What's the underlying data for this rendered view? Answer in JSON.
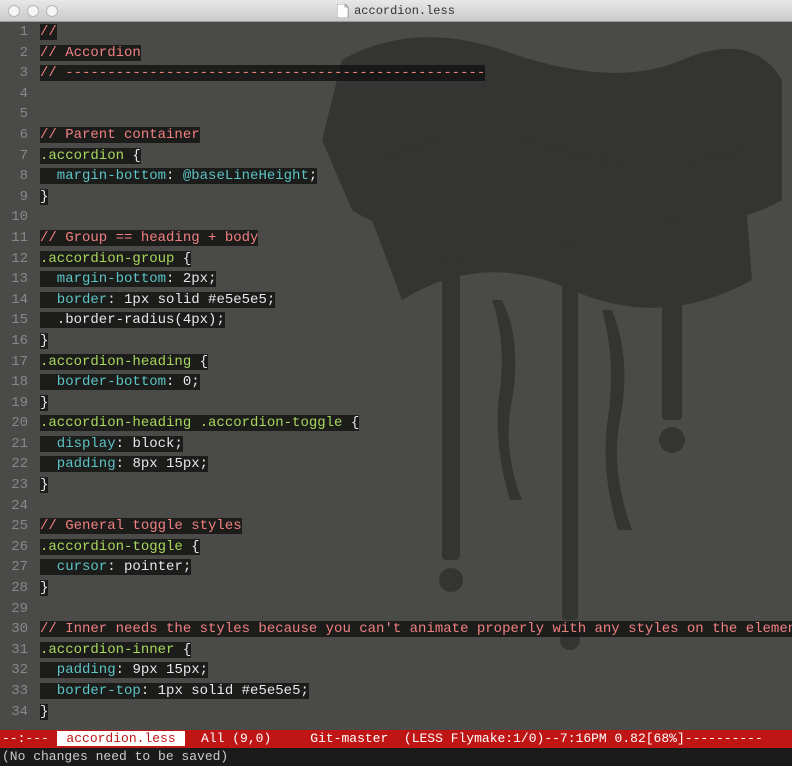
{
  "window": {
    "title": "accordion.less"
  },
  "gutter": {
    "start": 1,
    "end": 34
  },
  "code": [
    [
      {
        "t": "//",
        "c": "c-comment"
      }
    ],
    [
      {
        "t": "// Accordion",
        "c": "c-comment"
      }
    ],
    [
      {
        "t": "// --------------------------------------------------",
        "c": "c-comment"
      }
    ],
    [],
    [],
    [
      {
        "t": "// Parent container",
        "c": "c-comment"
      }
    ],
    [
      {
        "t": ".accordion ",
        "c": "c-selector"
      },
      {
        "t": "{",
        "c": "c-brace"
      }
    ],
    [
      {
        "t": "  margin-bottom",
        "c": "c-prop"
      },
      {
        "t": ": ",
        "c": "c-colon"
      },
      {
        "t": "@baseLineHeight",
        "c": "c-var"
      },
      {
        "t": ";",
        "c": "c-brace"
      }
    ],
    [
      {
        "t": "}",
        "c": "c-brace"
      }
    ],
    [],
    [
      {
        "t": "// Group == heading + body",
        "c": "c-comment"
      }
    ],
    [
      {
        "t": ".accordion-group ",
        "c": "c-selector"
      },
      {
        "t": "{",
        "c": "c-brace"
      }
    ],
    [
      {
        "t": "  margin-bottom",
        "c": "c-prop"
      },
      {
        "t": ": ",
        "c": "c-colon"
      },
      {
        "t": "2px",
        "c": "c-value"
      },
      {
        "t": ";",
        "c": "c-brace"
      }
    ],
    [
      {
        "t": "  border",
        "c": "c-prop"
      },
      {
        "t": ": ",
        "c": "c-colon"
      },
      {
        "t": "1px solid #e5e5e5",
        "c": "c-value"
      },
      {
        "t": ";",
        "c": "c-brace"
      }
    ],
    [
      {
        "t": "  .border-radius(4px)",
        "c": "c-mixin"
      },
      {
        "t": ";",
        "c": "c-brace"
      }
    ],
    [
      {
        "t": "}",
        "c": "c-brace"
      }
    ],
    [
      {
        "t": ".accordion-heading ",
        "c": "c-selector"
      },
      {
        "t": "{",
        "c": "c-brace"
      }
    ],
    [
      {
        "t": "  border-bottom",
        "c": "c-prop"
      },
      {
        "t": ": ",
        "c": "c-colon"
      },
      {
        "t": "0",
        "c": "c-value"
      },
      {
        "t": ";",
        "c": "c-brace"
      }
    ],
    [
      {
        "t": "}",
        "c": "c-brace"
      }
    ],
    [
      {
        "t": ".accordion-heading .accordion-toggle ",
        "c": "c-selector"
      },
      {
        "t": "{",
        "c": "c-brace"
      }
    ],
    [
      {
        "t": "  display",
        "c": "c-prop"
      },
      {
        "t": ": ",
        "c": "c-colon"
      },
      {
        "t": "block",
        "c": "c-value"
      },
      {
        "t": ";",
        "c": "c-brace"
      }
    ],
    [
      {
        "t": "  padding",
        "c": "c-prop"
      },
      {
        "t": ": ",
        "c": "c-colon"
      },
      {
        "t": "8px 15px",
        "c": "c-value"
      },
      {
        "t": ";",
        "c": "c-brace"
      }
    ],
    [
      {
        "t": "}",
        "c": "c-brace"
      }
    ],
    [],
    [
      {
        "t": "// General toggle styles",
        "c": "c-comment"
      }
    ],
    [
      {
        "t": ".accordion-toggle ",
        "c": "c-selector"
      },
      {
        "t": "{",
        "c": "c-brace"
      }
    ],
    [
      {
        "t": "  cursor",
        "c": "c-prop"
      },
      {
        "t": ": ",
        "c": "c-colon"
      },
      {
        "t": "pointer",
        "c": "c-value"
      },
      {
        "t": ";",
        "c": "c-brace"
      }
    ],
    [
      {
        "t": "}",
        "c": "c-brace"
      }
    ],
    [],
    [
      {
        "t": "// Inner needs the styles because you can't animate properly with any styles on the element",
        "c": "c-comment"
      }
    ],
    [
      {
        "t": ".accordion-inner ",
        "c": "c-selector"
      },
      {
        "t": "{",
        "c": "c-brace"
      }
    ],
    [
      {
        "t": "  padding",
        "c": "c-prop"
      },
      {
        "t": ": ",
        "c": "c-colon"
      },
      {
        "t": "9px 15px",
        "c": "c-value"
      },
      {
        "t": ";",
        "c": "c-brace"
      }
    ],
    [
      {
        "t": "  border-top",
        "c": "c-prop"
      },
      {
        "t": ": ",
        "c": "c-colon"
      },
      {
        "t": "1px solid #e5e5e5",
        "c": "c-value"
      },
      {
        "t": ";",
        "c": "c-brace"
      }
    ],
    [
      {
        "t": "}",
        "c": "c-brace"
      }
    ]
  ],
  "modeline": {
    "prefix": "--:--- ",
    "filename": " accordion.less ",
    "pos": "  All (9,0)     ",
    "vc": "Git-master  ",
    "modes": "(LESS Flymake:1/0)",
    "time": "--7:16PM 0.82[68%]",
    "dashes": "----------"
  },
  "minibuffer": "(No changes need to be saved)"
}
